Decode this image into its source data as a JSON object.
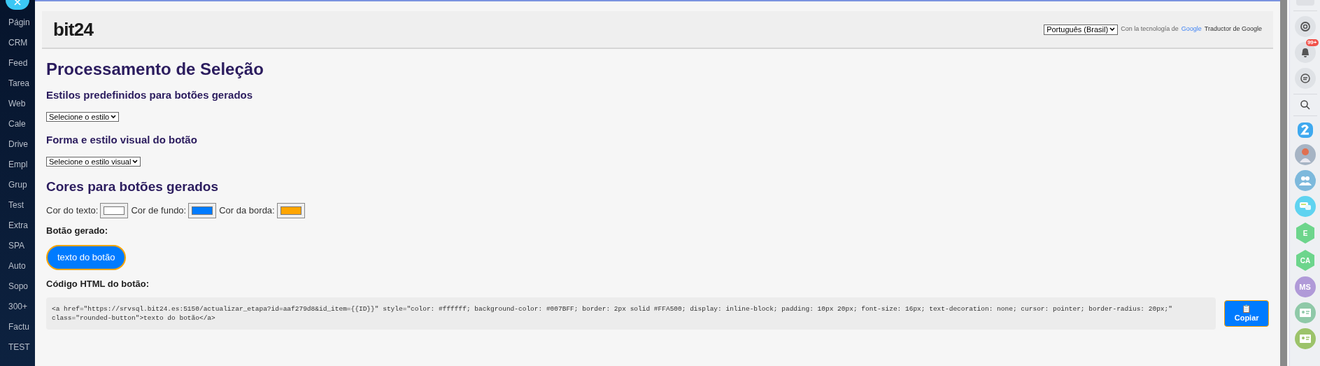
{
  "left_nav": {
    "items": [
      {
        "label": "Págin"
      },
      {
        "label": "CRM"
      },
      {
        "label": "Feed"
      },
      {
        "label": "Tarea"
      },
      {
        "label": "Web"
      },
      {
        "label": "Cale"
      },
      {
        "label": "Drive"
      },
      {
        "label": "Empl"
      },
      {
        "label": "Grup"
      },
      {
        "label": "Test"
      },
      {
        "label": "Extra"
      },
      {
        "label": "SPA"
      },
      {
        "label": "Auto"
      },
      {
        "label": "Sopo"
      },
      {
        "label": "300+"
      },
      {
        "label": "Factu"
      },
      {
        "label": "TEST"
      }
    ]
  },
  "header": {
    "logo": "bit24",
    "language_select": "Português (Brasil)",
    "powered_by": "Con la tecnología de",
    "google": "Google",
    "translator": "Traductor de Google"
  },
  "title": "Processamento de Seleção",
  "sections": [
    {
      "heading": "Estilos predefinidos para botões gerados",
      "select": "Selecione o estilo"
    },
    {
      "heading": "Forma e estilo visual do botão",
      "select": "Selecione o estilo visual"
    }
  ],
  "colors": {
    "heading": "Cores para botões gerados",
    "fields": [
      {
        "label": "Cor do texto:",
        "color": "#ffffff"
      },
      {
        "label": "Cor de fundo:",
        "color": "#007bff"
      },
      {
        "label": "Cor da borda:",
        "color": "#ffa500"
      }
    ]
  },
  "preview": {
    "label": "Botão gerado:",
    "button": "texto do botão"
  },
  "code": {
    "label": "Código HTML do botão:",
    "lines": [
      "<a href=\"https://srvsql.bit24.es:5150/actualizar_etapa?id=aaf279d8&id_item={{ID}}\" style=\"color: #ffffff; background-color: #007BFF; border: 2px solid #FFA500; display: inline-block; padding: 10px 20px; font-size: 16px; text-decoration: none; cursor: pointer; border-radius: 20px;\"",
      "class=\"rounded-button\">texto do botão</a>"
    ],
    "copy_icon": "📋",
    "copy": "Copiar"
  },
  "right_bar": {
    "notifications_badge": "99+",
    "avatars": [
      {
        "kind": "hex",
        "initials": "E",
        "color": "#6dd58c"
      },
      {
        "kind": "hex",
        "initials": "CA",
        "color": "#6dd58c"
      },
      {
        "kind": "circle",
        "initials": "MS",
        "color": "#b09ad8"
      }
    ]
  }
}
